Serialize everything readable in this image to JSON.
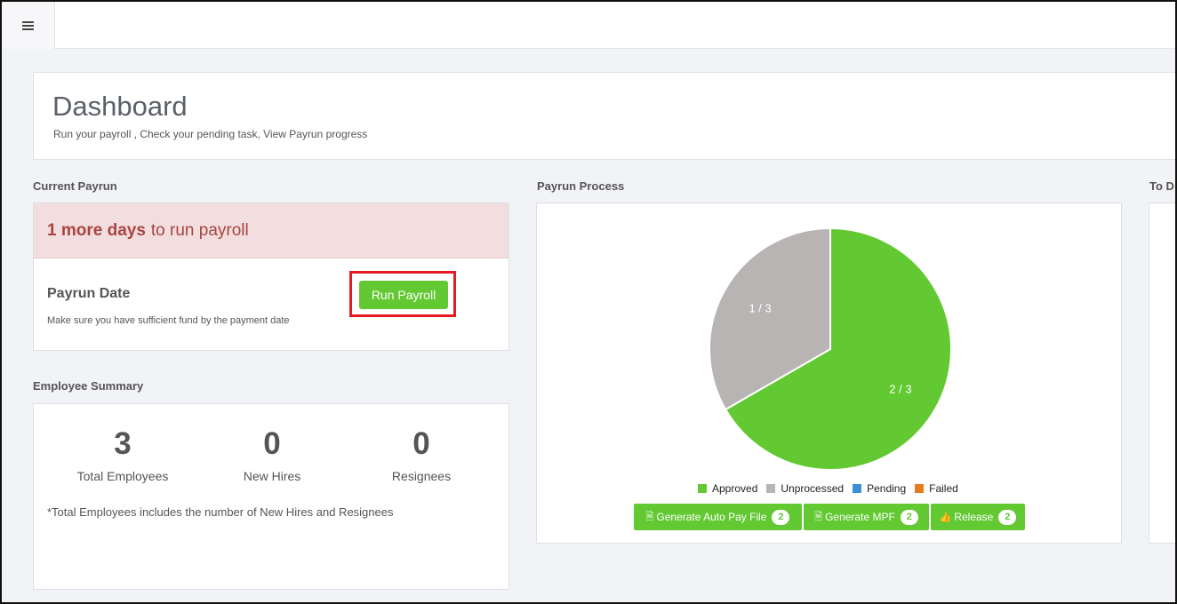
{
  "topbar": {
    "menu_icon": "hamburger-icon"
  },
  "header": {
    "title": "Dashboard",
    "subtitle": "Run your payroll , Check your pending task, View Payrun progress"
  },
  "current_payrun": {
    "section_label": "Current Payrun",
    "alert_bold": "1 more days",
    "alert_rest": "to run payroll",
    "date_label": "Payrun Date",
    "note": "Make sure you have sufficient fund by the payment date",
    "run_button": "Run Payroll"
  },
  "employee_summary": {
    "section_label": "Employee Summary",
    "stats": [
      {
        "value": "3",
        "label": "Total Employees"
      },
      {
        "value": "0",
        "label": "New Hires"
      },
      {
        "value": "0",
        "label": "Resignees"
      }
    ],
    "note": "*Total Employees includes the number of New Hires and Resignees"
  },
  "payrun_process": {
    "section_label": "Payrun Process",
    "legend": [
      {
        "label": "Approved",
        "color": "#62c933"
      },
      {
        "label": "Unprocessed",
        "color": "#b8b4b4"
      },
      {
        "label": "Pending",
        "color": "#3a8fd6"
      },
      {
        "label": "Failed",
        "color": "#e87a1e"
      }
    ],
    "buttons": [
      {
        "label": "Generate Auto Pay File",
        "icon": "document-icon",
        "count": "2"
      },
      {
        "label": "Generate MPF",
        "icon": "document-icon",
        "count": "2"
      },
      {
        "label": "Release",
        "icon": "thumbs-up-icon",
        "count": "2"
      }
    ]
  },
  "todo": {
    "section_label": "To D"
  },
  "chart_data": {
    "type": "pie",
    "categories": [
      "Approved",
      "Unprocessed",
      "Pending",
      "Failed"
    ],
    "values": [
      2,
      1,
      0,
      0
    ],
    "slice_labels": [
      "2 / 3",
      "1 / 3",
      "",
      ""
    ],
    "colors": [
      "#62c933",
      "#b8b4b4",
      "#3a8fd6",
      "#e87a1e"
    ],
    "legend_position": "bottom"
  }
}
